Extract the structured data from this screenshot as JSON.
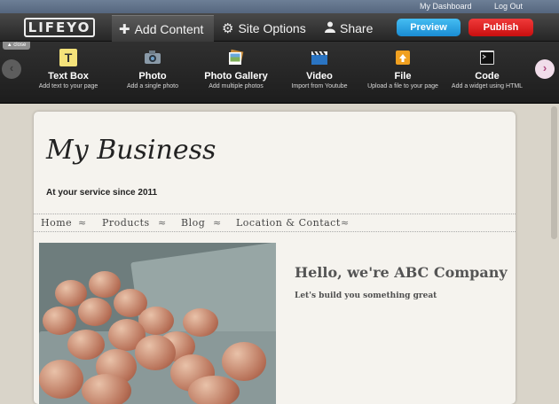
{
  "topbar": {
    "dashboard_link": "My Dashboard",
    "logout_link": "Log Out"
  },
  "header": {
    "logo": "LIFEYO",
    "tabs": [
      {
        "label": "Add Content",
        "icon": "plus-icon"
      },
      {
        "label": "Site Options",
        "icon": "gear-icon"
      },
      {
        "label": "Share",
        "icon": "person-icon"
      }
    ],
    "preview_label": "Preview",
    "publish_label": "Publish"
  },
  "toolbar": {
    "close_label": "close",
    "tools": [
      {
        "label": "Text Box",
        "desc": "Add text to your page",
        "icon": "text-box-icon"
      },
      {
        "label": "Photo",
        "desc": "Add a single photo",
        "icon": "camera-icon"
      },
      {
        "label": "Photo Gallery",
        "desc": "Add multiple photos",
        "icon": "gallery-icon"
      },
      {
        "label": "Video",
        "desc": "Import from Youtube",
        "icon": "clapperboard-icon"
      },
      {
        "label": "File",
        "desc": "Upload a file to your page",
        "icon": "file-icon"
      },
      {
        "label": "Code",
        "desc": "Add a widget using HTML",
        "icon": "terminal-icon"
      }
    ]
  },
  "site": {
    "title": "My Business",
    "tagline": "At your service since 2011",
    "nav": [
      "Home",
      "Products",
      "Blog",
      "Location & Contact"
    ],
    "nav_separator": "≈",
    "hello": "Hello, we're ABC Company",
    "subheading": "Let's build you something great"
  },
  "colors": {
    "preview": "#2aa6e6",
    "publish": "#e02020",
    "accent_arrow": "#b14c81"
  }
}
